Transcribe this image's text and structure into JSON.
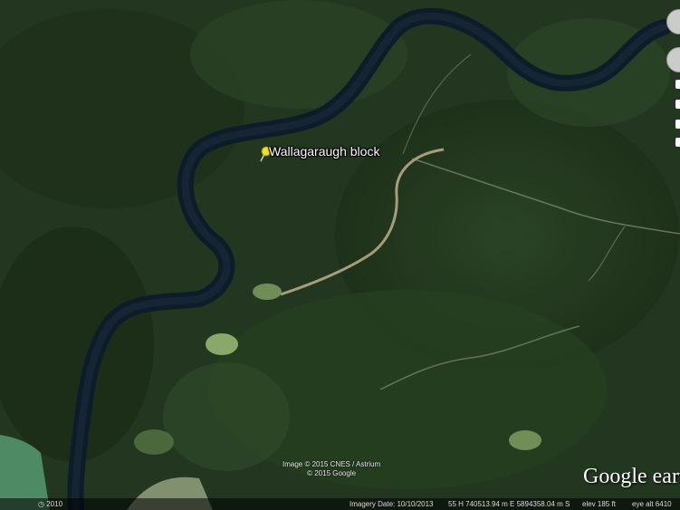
{
  "placemark": {
    "label": "Wallagaraugh block",
    "pin_icon": "yellow-pushpin-icon",
    "pin_color": "#f0e020"
  },
  "imagery_credits": {
    "line1": "Image © 2015 CNES / Astrium",
    "line2": "© 2015 Google"
  },
  "logo": {
    "text": "Google earth"
  },
  "status_bar": {
    "year": "2010",
    "imagery_date": "Imagery Date: 10/10/2013",
    "coordinates": "55 H 740513.94 m E 5894358.04 m S",
    "elevation": "elev   185 ft",
    "eye_alt": "eye alt   6410"
  },
  "colors": {
    "river": "#0e1c2a",
    "forest": "#243a1e",
    "clearing": "#8aa86a",
    "track": "#c8b890"
  }
}
